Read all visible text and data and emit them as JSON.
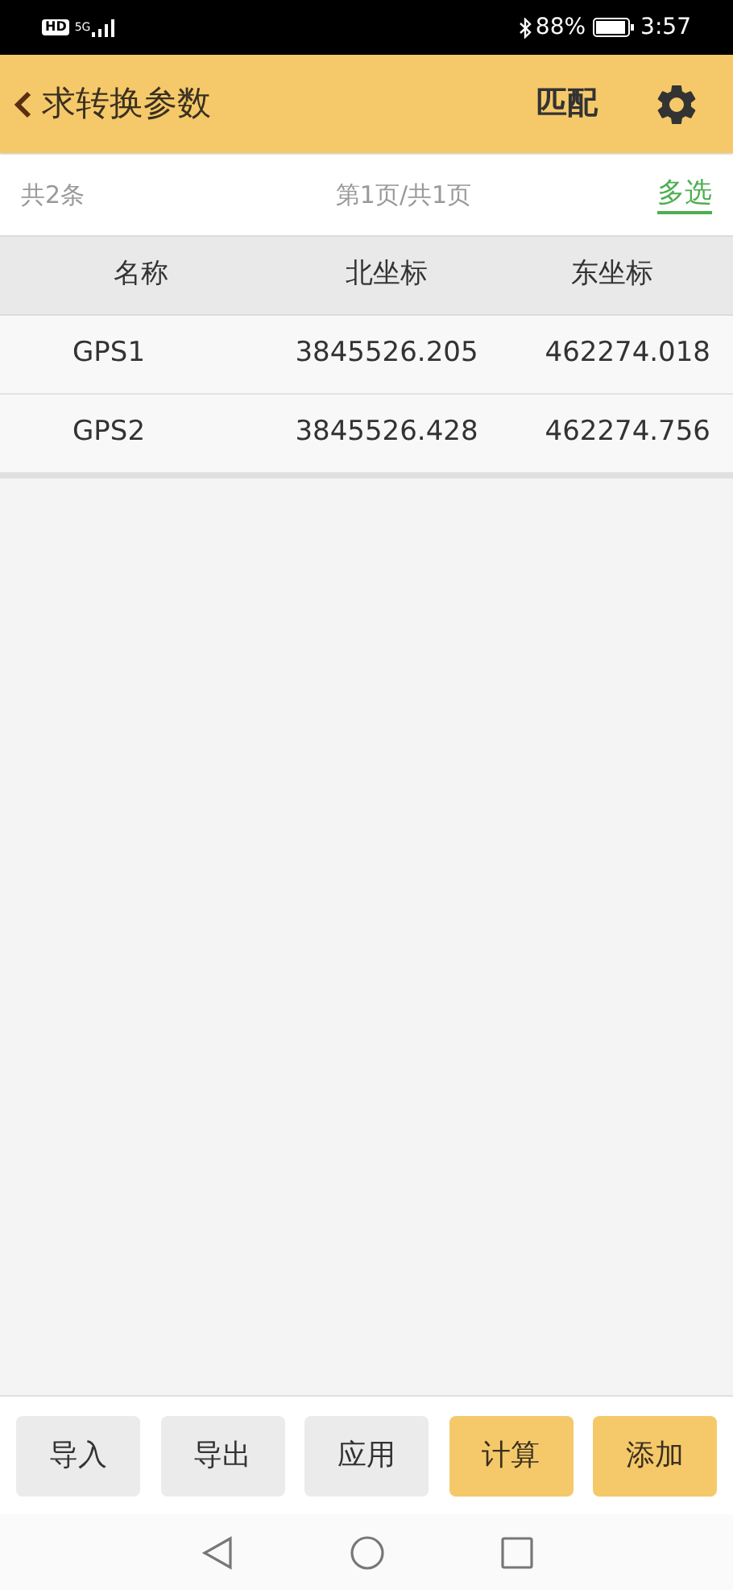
{
  "status_bar": {
    "network_badge": "HD",
    "network_type": "5G",
    "battery": "88%",
    "time": "3:57"
  },
  "header": {
    "title": "求转换参数",
    "action": "匹配"
  },
  "info_bar": {
    "count": "共2条",
    "page": "第1页/共1页",
    "multi_select": "多选"
  },
  "table": {
    "columns": [
      "名称",
      "北坐标",
      "东坐标"
    ],
    "rows": [
      [
        "GPS1",
        "3845526.205",
        "462274.018"
      ],
      [
        "GPS2",
        "3845526.428",
        "462274.756"
      ]
    ]
  },
  "buttons": [
    {
      "label": "导入",
      "kind": "default"
    },
    {
      "label": "导出",
      "kind": "default"
    },
    {
      "label": "应用",
      "kind": "default"
    },
    {
      "label": "计算",
      "kind": "primary"
    },
    {
      "label": "添加",
      "kind": "primary"
    }
  ]
}
